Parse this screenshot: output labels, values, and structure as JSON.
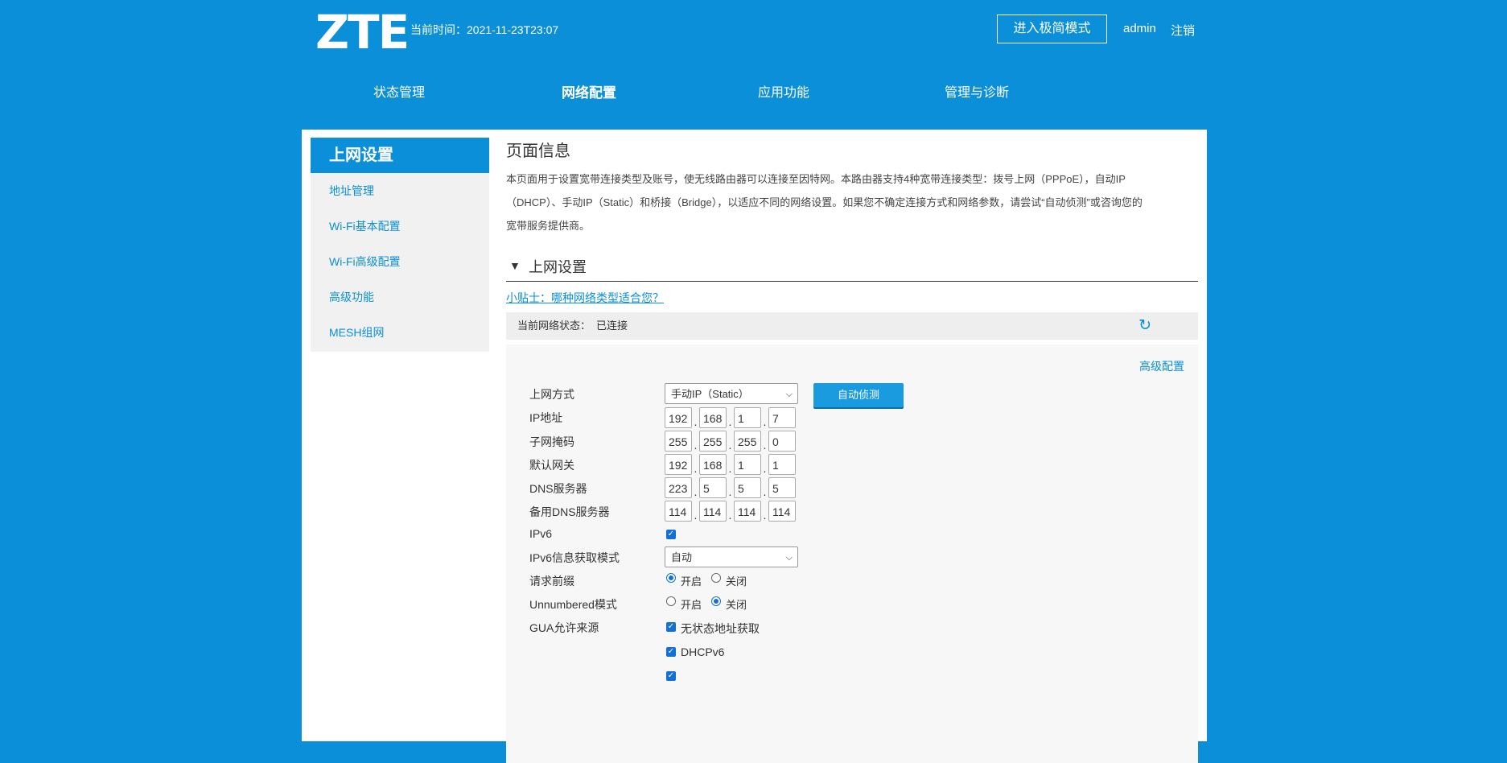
{
  "header": {
    "logo": "ZTE",
    "time_label": "当前时间：2021-11-23T23:07",
    "simple_mode_button": "进入极简模式",
    "user": "admin",
    "logout": "注销"
  },
  "nav": [
    {
      "label": "状态管理"
    },
    {
      "label": "网络配置"
    },
    {
      "label": "应用功能"
    },
    {
      "label": "管理与诊断"
    }
  ],
  "sidebar": {
    "title": "上网设置",
    "items": [
      {
        "label": "地址管理"
      },
      {
        "label": "Wi-Fi基本配置"
      },
      {
        "label": "Wi-Fi高级配置"
      },
      {
        "label": "高级功能"
      },
      {
        "label": "MESH组网"
      }
    ]
  },
  "page": {
    "title": "页面信息",
    "desc1": "本页面用于设置宽带连接类型及账号，使无线路由器可以连接至因特网。本路由器支持4种宽带连接类型：拨号上网（PPPoE），自动IP",
    "desc2": "（DHCP）、手动IP（Static）和桥接（Bridge），以适应不同的网络设置。如果您不确定连接方式和网络参数，请尝试“自动侦测”或咨询您的",
    "desc3": "宽带服务提供商。",
    "section_title": "上网设置",
    "tip": "小贴士：哪种网络类型适合您？",
    "status_label": "当前网络状态：",
    "status_value": "已连接",
    "advanced_link": "高级配置"
  },
  "form": {
    "conn_type_label": "上网方式",
    "conn_type_value": "手动IP（Static）",
    "detect_button": "自动侦测",
    "ip_label": "IP地址",
    "ip": [
      "192",
      "168",
      "1",
      "7"
    ],
    "mask_label": "子网掩码",
    "mask": [
      "255",
      "255",
      "255",
      "0"
    ],
    "gateway_label": "默认网关",
    "gateway": [
      "192",
      "168",
      "1",
      "1"
    ],
    "dns_label": "DNS服务器",
    "dns": [
      "223",
      "5",
      "5",
      "5"
    ],
    "dns2_label": "备用DNS服务器",
    "dns2": [
      "114",
      "114",
      "114",
      "114"
    ],
    "ipv6_label": "IPv6",
    "ipv6_mode_label": "IPv6信息获取模式",
    "ipv6_mode_value": "自动",
    "prefix_label": "请求前缀",
    "unnumbered_label": "Unnumbered模式",
    "on": "开启",
    "off": "关闭",
    "gua_label": "GUA允许来源",
    "gua_opt1": "无状态地址获取",
    "gua_opt2": "DHCPv6"
  },
  "colors": {
    "brand": "#0a8fd8",
    "check": "#1470d6"
  }
}
